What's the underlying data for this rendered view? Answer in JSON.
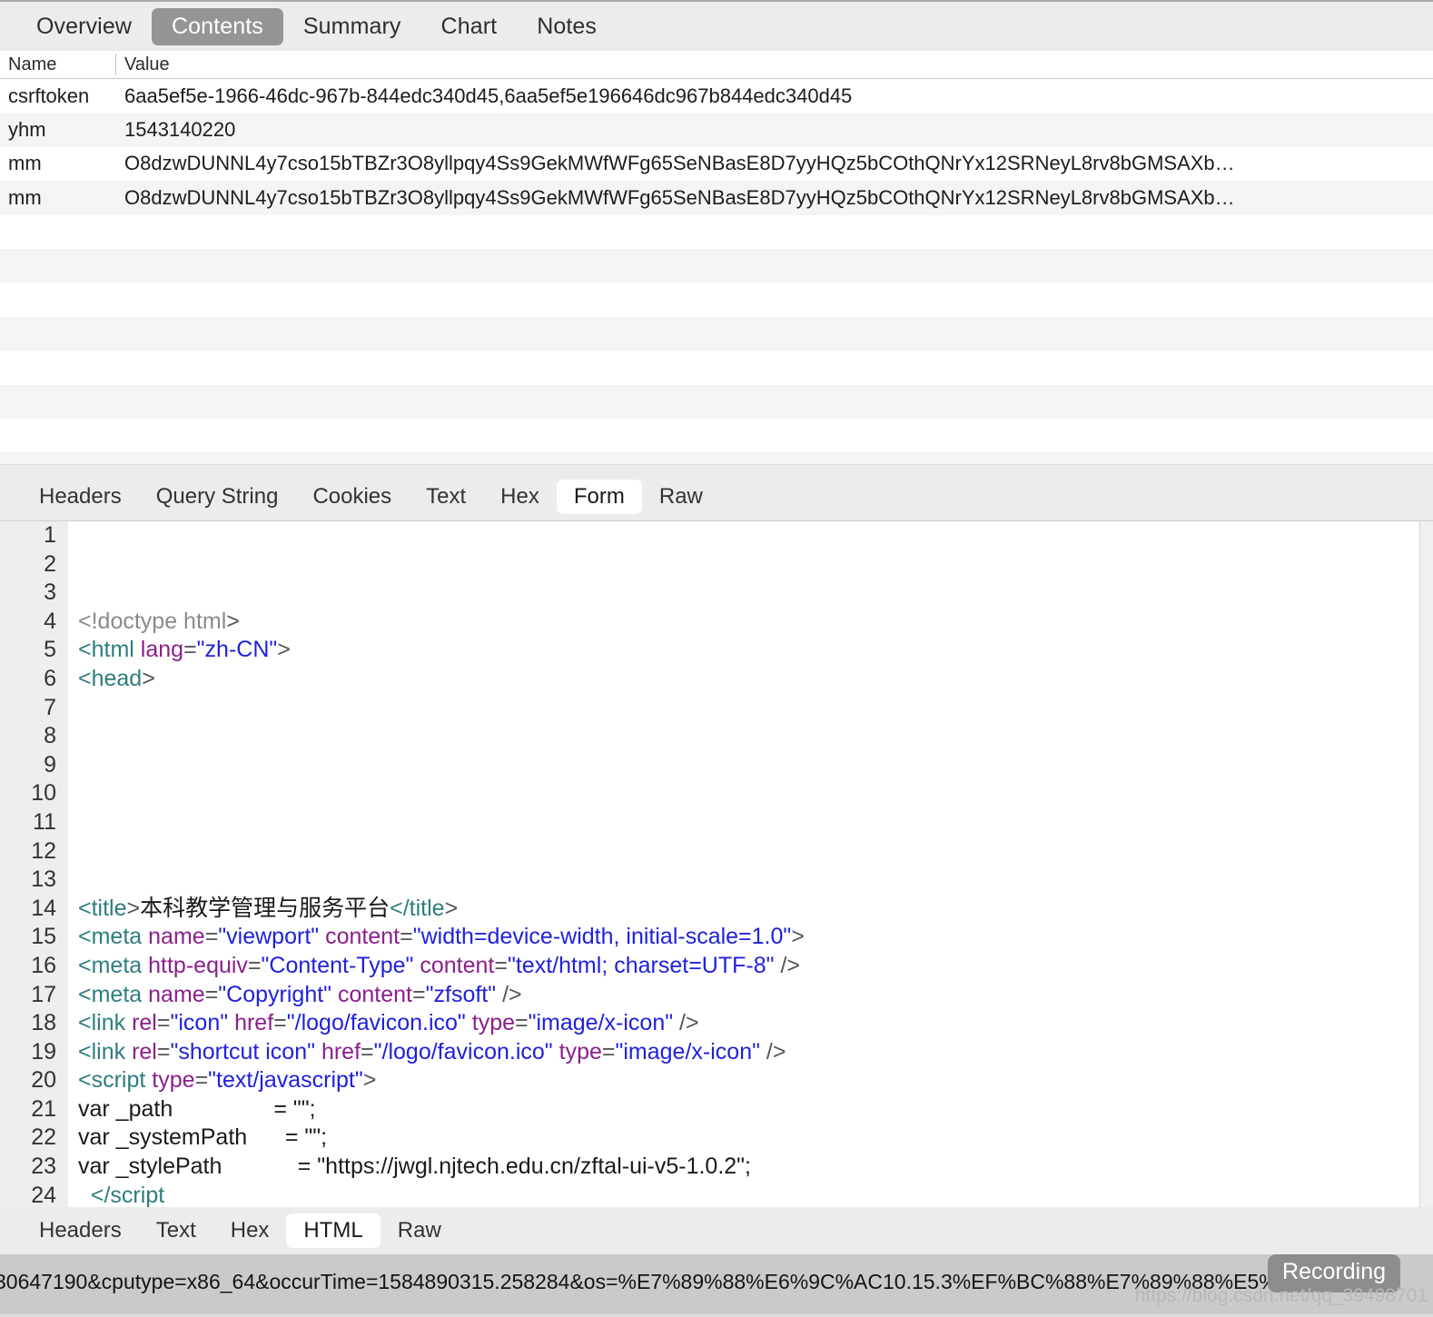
{
  "top_tabs": [
    {
      "label": "Overview",
      "active": false
    },
    {
      "label": "Contents",
      "active": true
    },
    {
      "label": "Summary",
      "active": false
    },
    {
      "label": "Chart",
      "active": false
    },
    {
      "label": "Notes",
      "active": false
    }
  ],
  "table": {
    "columns": [
      "Name",
      "Value"
    ],
    "rows": [
      {
        "name": "csrftoken",
        "value": "6aa5ef5e-1966-46dc-967b-844edc340d45,6aa5ef5e196646dc967b844edc340d45"
      },
      {
        "name": "yhm",
        "value": "1543140220"
      },
      {
        "name": "mm",
        "value": "O8dzwDUNNL4y7cso15bTBZr3O8yllpqy4Ss9GekMWfWFg65SeNBasE8D7yyHQz5bCOthQNrYx12SRNeyL8rv8bGMSAXb…"
      },
      {
        "name": "mm",
        "value": "O8dzwDUNNL4y7cso15bTBZr3O8yllpqy4Ss9GekMWfWFg65SeNBasE8D7yyHQz5bCOthQNrYx12SRNeyL8rv8bGMSAXb…"
      }
    ],
    "empty_row_count": 8
  },
  "mid_tabs": [
    {
      "label": "Headers",
      "active": false
    },
    {
      "label": "Query String",
      "active": false
    },
    {
      "label": "Cookies",
      "active": false
    },
    {
      "label": "Text",
      "active": false
    },
    {
      "label": "Hex",
      "active": false
    },
    {
      "label": "Form",
      "active": true
    },
    {
      "label": "Raw",
      "active": false
    }
  ],
  "code": {
    "lines": [
      {
        "n": "1",
        "tokens": []
      },
      {
        "n": "2",
        "tokens": []
      },
      {
        "n": "3",
        "tokens": []
      },
      {
        "n": "4",
        "tokens": [
          {
            "t": "<!doctype html",
            "c": "tok-dim"
          },
          {
            "t": ">",
            "c": "tok-punct"
          }
        ]
      },
      {
        "n": "5",
        "tokens": [
          {
            "t": "<html",
            "c": "tok-tag"
          },
          {
            "t": " ",
            "c": "tok-plain"
          },
          {
            "t": "lang",
            "c": "tok-attr"
          },
          {
            "t": "=",
            "c": "tok-punct"
          },
          {
            "t": "\"zh-CN\"",
            "c": "tok-val"
          },
          {
            "t": ">",
            "c": "tok-punct"
          }
        ]
      },
      {
        "n": "6",
        "tokens": [
          {
            "t": "<head",
            "c": "tok-tag"
          },
          {
            "t": ">",
            "c": "tok-punct"
          }
        ]
      },
      {
        "n": "7",
        "tokens": []
      },
      {
        "n": "8",
        "tokens": []
      },
      {
        "n": "9",
        "tokens": []
      },
      {
        "n": "10",
        "tokens": []
      },
      {
        "n": "11",
        "tokens": []
      },
      {
        "n": "12",
        "tokens": []
      },
      {
        "n": "13",
        "tokens": []
      },
      {
        "n": "14",
        "tokens": [
          {
            "t": "<title",
            "c": "tok-tag"
          },
          {
            "t": ">",
            "c": "tok-punct"
          },
          {
            "t": "本科教学管理与服务平台",
            "c": "tok-plain"
          },
          {
            "t": "</title",
            "c": "tok-tag"
          },
          {
            "t": ">",
            "c": "tok-punct"
          }
        ]
      },
      {
        "n": "15",
        "tokens": [
          {
            "t": "<meta",
            "c": "tok-tag"
          },
          {
            "t": " ",
            "c": "tok-plain"
          },
          {
            "t": "name",
            "c": "tok-attr"
          },
          {
            "t": "=",
            "c": "tok-punct"
          },
          {
            "t": "\"viewport\"",
            "c": "tok-val"
          },
          {
            "t": " ",
            "c": "tok-plain"
          },
          {
            "t": "content",
            "c": "tok-attr"
          },
          {
            "t": "=",
            "c": "tok-punct"
          },
          {
            "t": "\"width=device-width, initial-scale=1.0\"",
            "c": "tok-val"
          },
          {
            "t": ">",
            "c": "tok-punct"
          }
        ]
      },
      {
        "n": "16",
        "tokens": [
          {
            "t": "<meta",
            "c": "tok-tag"
          },
          {
            "t": " ",
            "c": "tok-plain"
          },
          {
            "t": "http-equiv",
            "c": "tok-attr"
          },
          {
            "t": "=",
            "c": "tok-punct"
          },
          {
            "t": "\"Content-Type\"",
            "c": "tok-val"
          },
          {
            "t": " ",
            "c": "tok-plain"
          },
          {
            "t": "content",
            "c": "tok-attr"
          },
          {
            "t": "=",
            "c": "tok-punct"
          },
          {
            "t": "\"text/html; charset=UTF-8\"",
            "c": "tok-val"
          },
          {
            "t": " />",
            "c": "tok-punct"
          }
        ]
      },
      {
        "n": "17",
        "tokens": [
          {
            "t": "<meta",
            "c": "tok-tag"
          },
          {
            "t": " ",
            "c": "tok-plain"
          },
          {
            "t": "name",
            "c": "tok-attr"
          },
          {
            "t": "=",
            "c": "tok-punct"
          },
          {
            "t": "\"Copyright\"",
            "c": "tok-val"
          },
          {
            "t": " ",
            "c": "tok-plain"
          },
          {
            "t": "content",
            "c": "tok-attr"
          },
          {
            "t": "=",
            "c": "tok-punct"
          },
          {
            "t": "\"zfsoft\"",
            "c": "tok-val"
          },
          {
            "t": " />",
            "c": "tok-punct"
          }
        ]
      },
      {
        "n": "18",
        "tokens": [
          {
            "t": "<link",
            "c": "tok-tag"
          },
          {
            "t": " ",
            "c": "tok-plain"
          },
          {
            "t": "rel",
            "c": "tok-attr"
          },
          {
            "t": "=",
            "c": "tok-punct"
          },
          {
            "t": "\"icon\"",
            "c": "tok-val"
          },
          {
            "t": " ",
            "c": "tok-plain"
          },
          {
            "t": "href",
            "c": "tok-attr"
          },
          {
            "t": "=",
            "c": "tok-punct"
          },
          {
            "t": "\"/logo/favicon.ico\"",
            "c": "tok-val"
          },
          {
            "t": " ",
            "c": "tok-plain"
          },
          {
            "t": "type",
            "c": "tok-attr"
          },
          {
            "t": "=",
            "c": "tok-punct"
          },
          {
            "t": "\"image/x-icon\"",
            "c": "tok-val"
          },
          {
            "t": " />",
            "c": "tok-punct"
          }
        ]
      },
      {
        "n": "19",
        "tokens": [
          {
            "t": "<link",
            "c": "tok-tag"
          },
          {
            "t": " ",
            "c": "tok-plain"
          },
          {
            "t": "rel",
            "c": "tok-attr"
          },
          {
            "t": "=",
            "c": "tok-punct"
          },
          {
            "t": "\"shortcut icon\"",
            "c": "tok-val"
          },
          {
            "t": " ",
            "c": "tok-plain"
          },
          {
            "t": "href",
            "c": "tok-attr"
          },
          {
            "t": "=",
            "c": "tok-punct"
          },
          {
            "t": "\"/logo/favicon.ico\"",
            "c": "tok-val"
          },
          {
            "t": " ",
            "c": "tok-plain"
          },
          {
            "t": "type",
            "c": "tok-attr"
          },
          {
            "t": "=",
            "c": "tok-punct"
          },
          {
            "t": "\"image/x-icon\"",
            "c": "tok-val"
          },
          {
            "t": " />",
            "c": "tok-punct"
          }
        ]
      },
      {
        "n": "20",
        "tokens": [
          {
            "t": "<script",
            "c": "tok-tag"
          },
          {
            "t": " ",
            "c": "tok-plain"
          },
          {
            "t": "type",
            "c": "tok-attr"
          },
          {
            "t": "=",
            "c": "tok-punct"
          },
          {
            "t": "\"text/javascript\"",
            "c": "tok-val"
          },
          {
            "t": ">",
            "c": "tok-punct"
          }
        ]
      },
      {
        "n": "21",
        "tokens": [
          {
            "t": "var _path                = \"\";",
            "c": "tok-plain"
          }
        ]
      },
      {
        "n": "22",
        "tokens": [
          {
            "t": "var _systemPath      = \"\";",
            "c": "tok-plain"
          }
        ]
      },
      {
        "n": "23",
        "tokens": [
          {
            "t": "var _stylePath            = \"https://jwgl.njtech.edu.cn/zftal-ui-v5-1.0.2\";",
            "c": "tok-plain"
          }
        ]
      },
      {
        "n": "24",
        "tokens": [
          {
            "t": "  </script",
            "c": "tok-tag"
          }
        ]
      }
    ]
  },
  "bottom_tabs": [
    {
      "label": "Headers",
      "active": false
    },
    {
      "label": "Text",
      "active": false
    },
    {
      "label": "Hex",
      "active": false
    },
    {
      "label": "HTML",
      "active": true
    },
    {
      "label": "Raw",
      "active": false
    }
  ],
  "statusbar": {
    "text": "30647190&cputype=x86_64&occurTime=1584890315.258284&os=%E7%89%88%E6%9C%AC10.15.3%EF%BC%88%E7%89%88%E5%8…",
    "recording_label": "Recording",
    "watermark": "https://blog.csdn.net/qq_39498701"
  },
  "colors": {
    "active_tab_bg": "#959595",
    "toolbar_bg": "#ececec",
    "row_alt_bg": "#f4f4f4",
    "status_bg": "#cacaca",
    "tag": "#2e7d7d",
    "attr": "#8b1f8b",
    "value": "#2020dd"
  }
}
